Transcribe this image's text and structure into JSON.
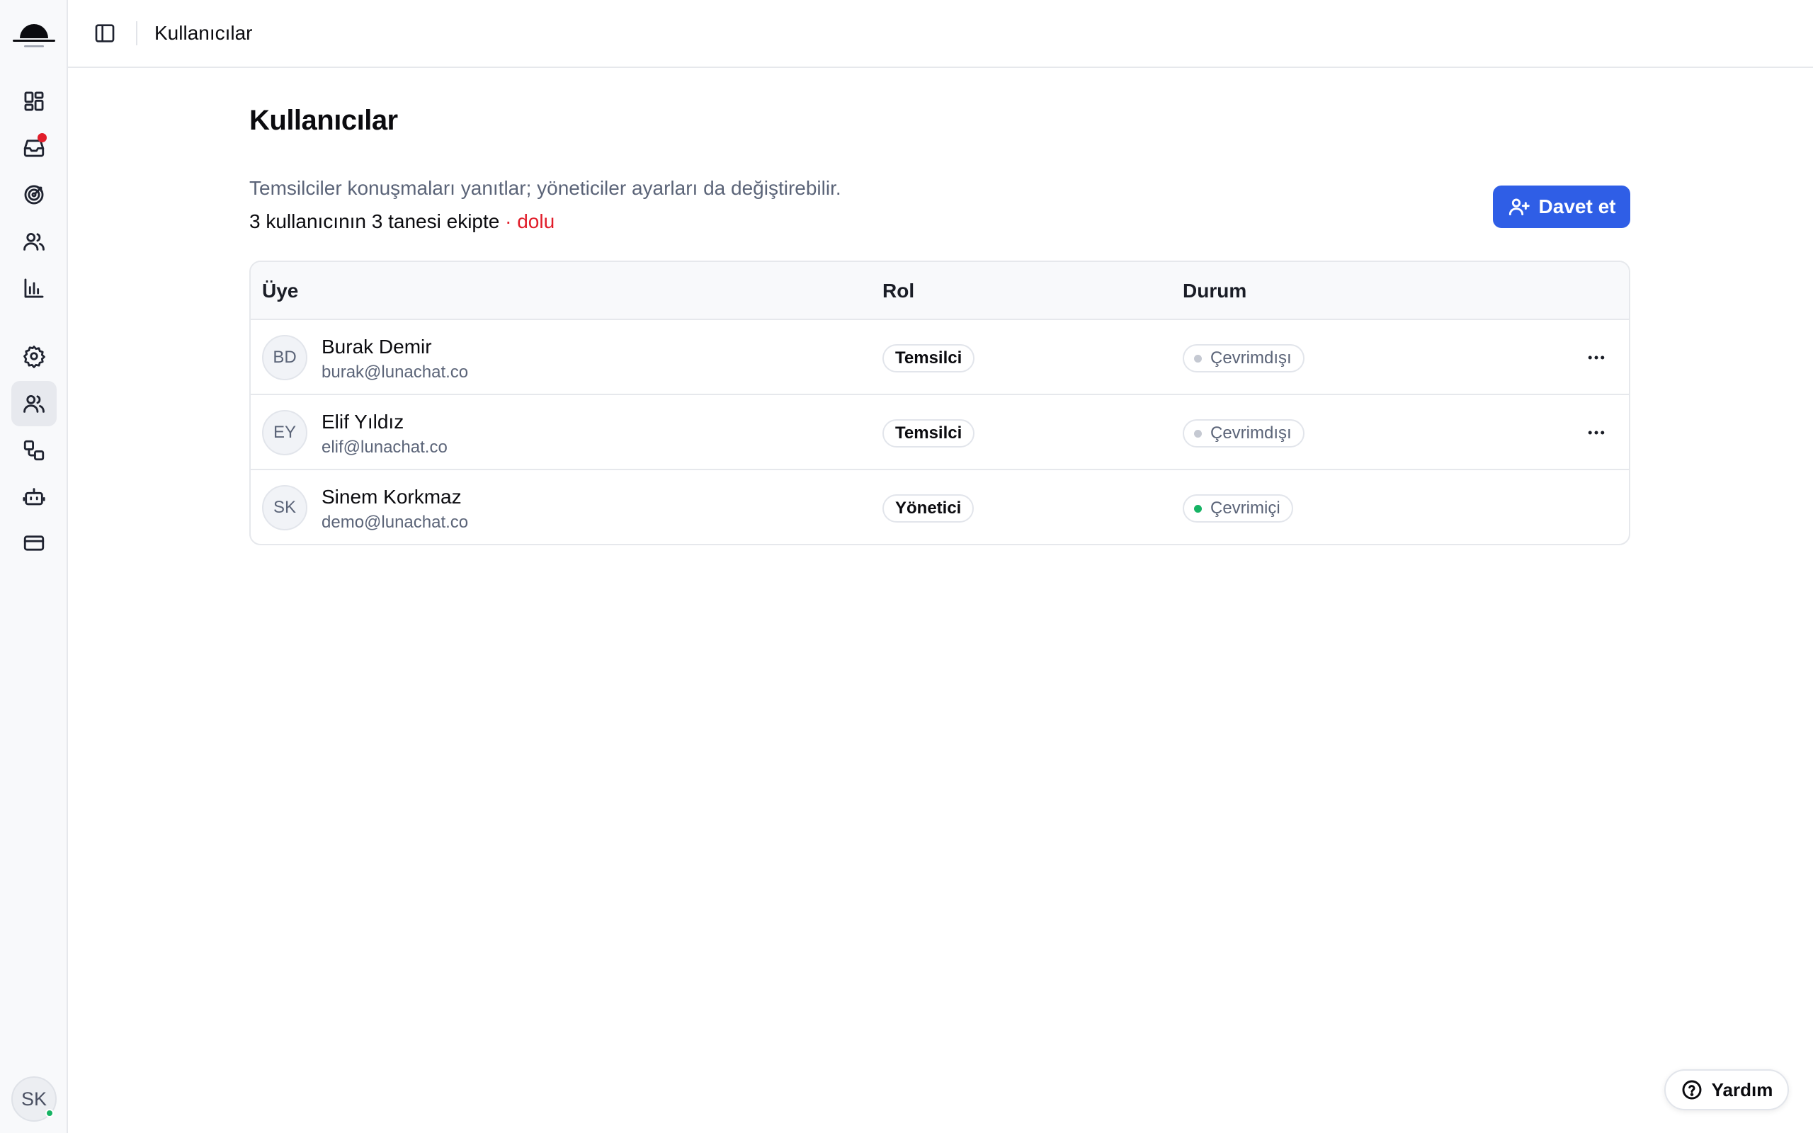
{
  "topbar": {
    "title": "Kullanıcılar"
  },
  "sidebar": {
    "items": [
      {
        "icon": "dashboard-icon"
      },
      {
        "icon": "inbox-icon",
        "badge": true
      },
      {
        "icon": "target-icon"
      },
      {
        "icon": "contacts-icon"
      },
      {
        "icon": "reports-icon"
      },
      {
        "icon": "settings-icon"
      },
      {
        "icon": "users-icon",
        "active": true
      },
      {
        "icon": "integrations-icon"
      },
      {
        "icon": "bot-icon"
      },
      {
        "icon": "billing-icon"
      }
    ],
    "user_initials": "SK"
  },
  "page": {
    "title": "Kullanıcılar",
    "subtitle": "Temsilciler konuşmaları yanıtlar; yöneticiler ayarları da değiştirebilir.",
    "count": "3 kullanıcının 3 tanesi ekipte",
    "full_sep": " · ",
    "full_label": "dolu",
    "invite_label": "Davet et"
  },
  "table": {
    "headers": {
      "member": "Üye",
      "role": "Rol",
      "status": "Durum"
    },
    "rows": [
      {
        "initials": "BD",
        "name": "Burak Demir",
        "email": "burak@lunachat.co",
        "role": "Temsilci",
        "status": "Çevrimdışı",
        "online": false,
        "has_menu": true
      },
      {
        "initials": "EY",
        "name": "Elif Yıldız",
        "email": "elif@lunachat.co",
        "role": "Temsilci",
        "status": "Çevrimdışı",
        "online": false,
        "has_menu": true
      },
      {
        "initials": "SK",
        "name": "Sinem Korkmaz",
        "email": "demo@lunachat.co",
        "role": "Yönetici",
        "status": "Çevrimiçi",
        "online": true,
        "has_menu": false
      }
    ]
  },
  "help": {
    "label": "Yardım"
  },
  "colors": {
    "accent": "#2f5ee6",
    "danger": "#e11d2a",
    "online": "#16b364",
    "offline": "#c5c9d2"
  }
}
